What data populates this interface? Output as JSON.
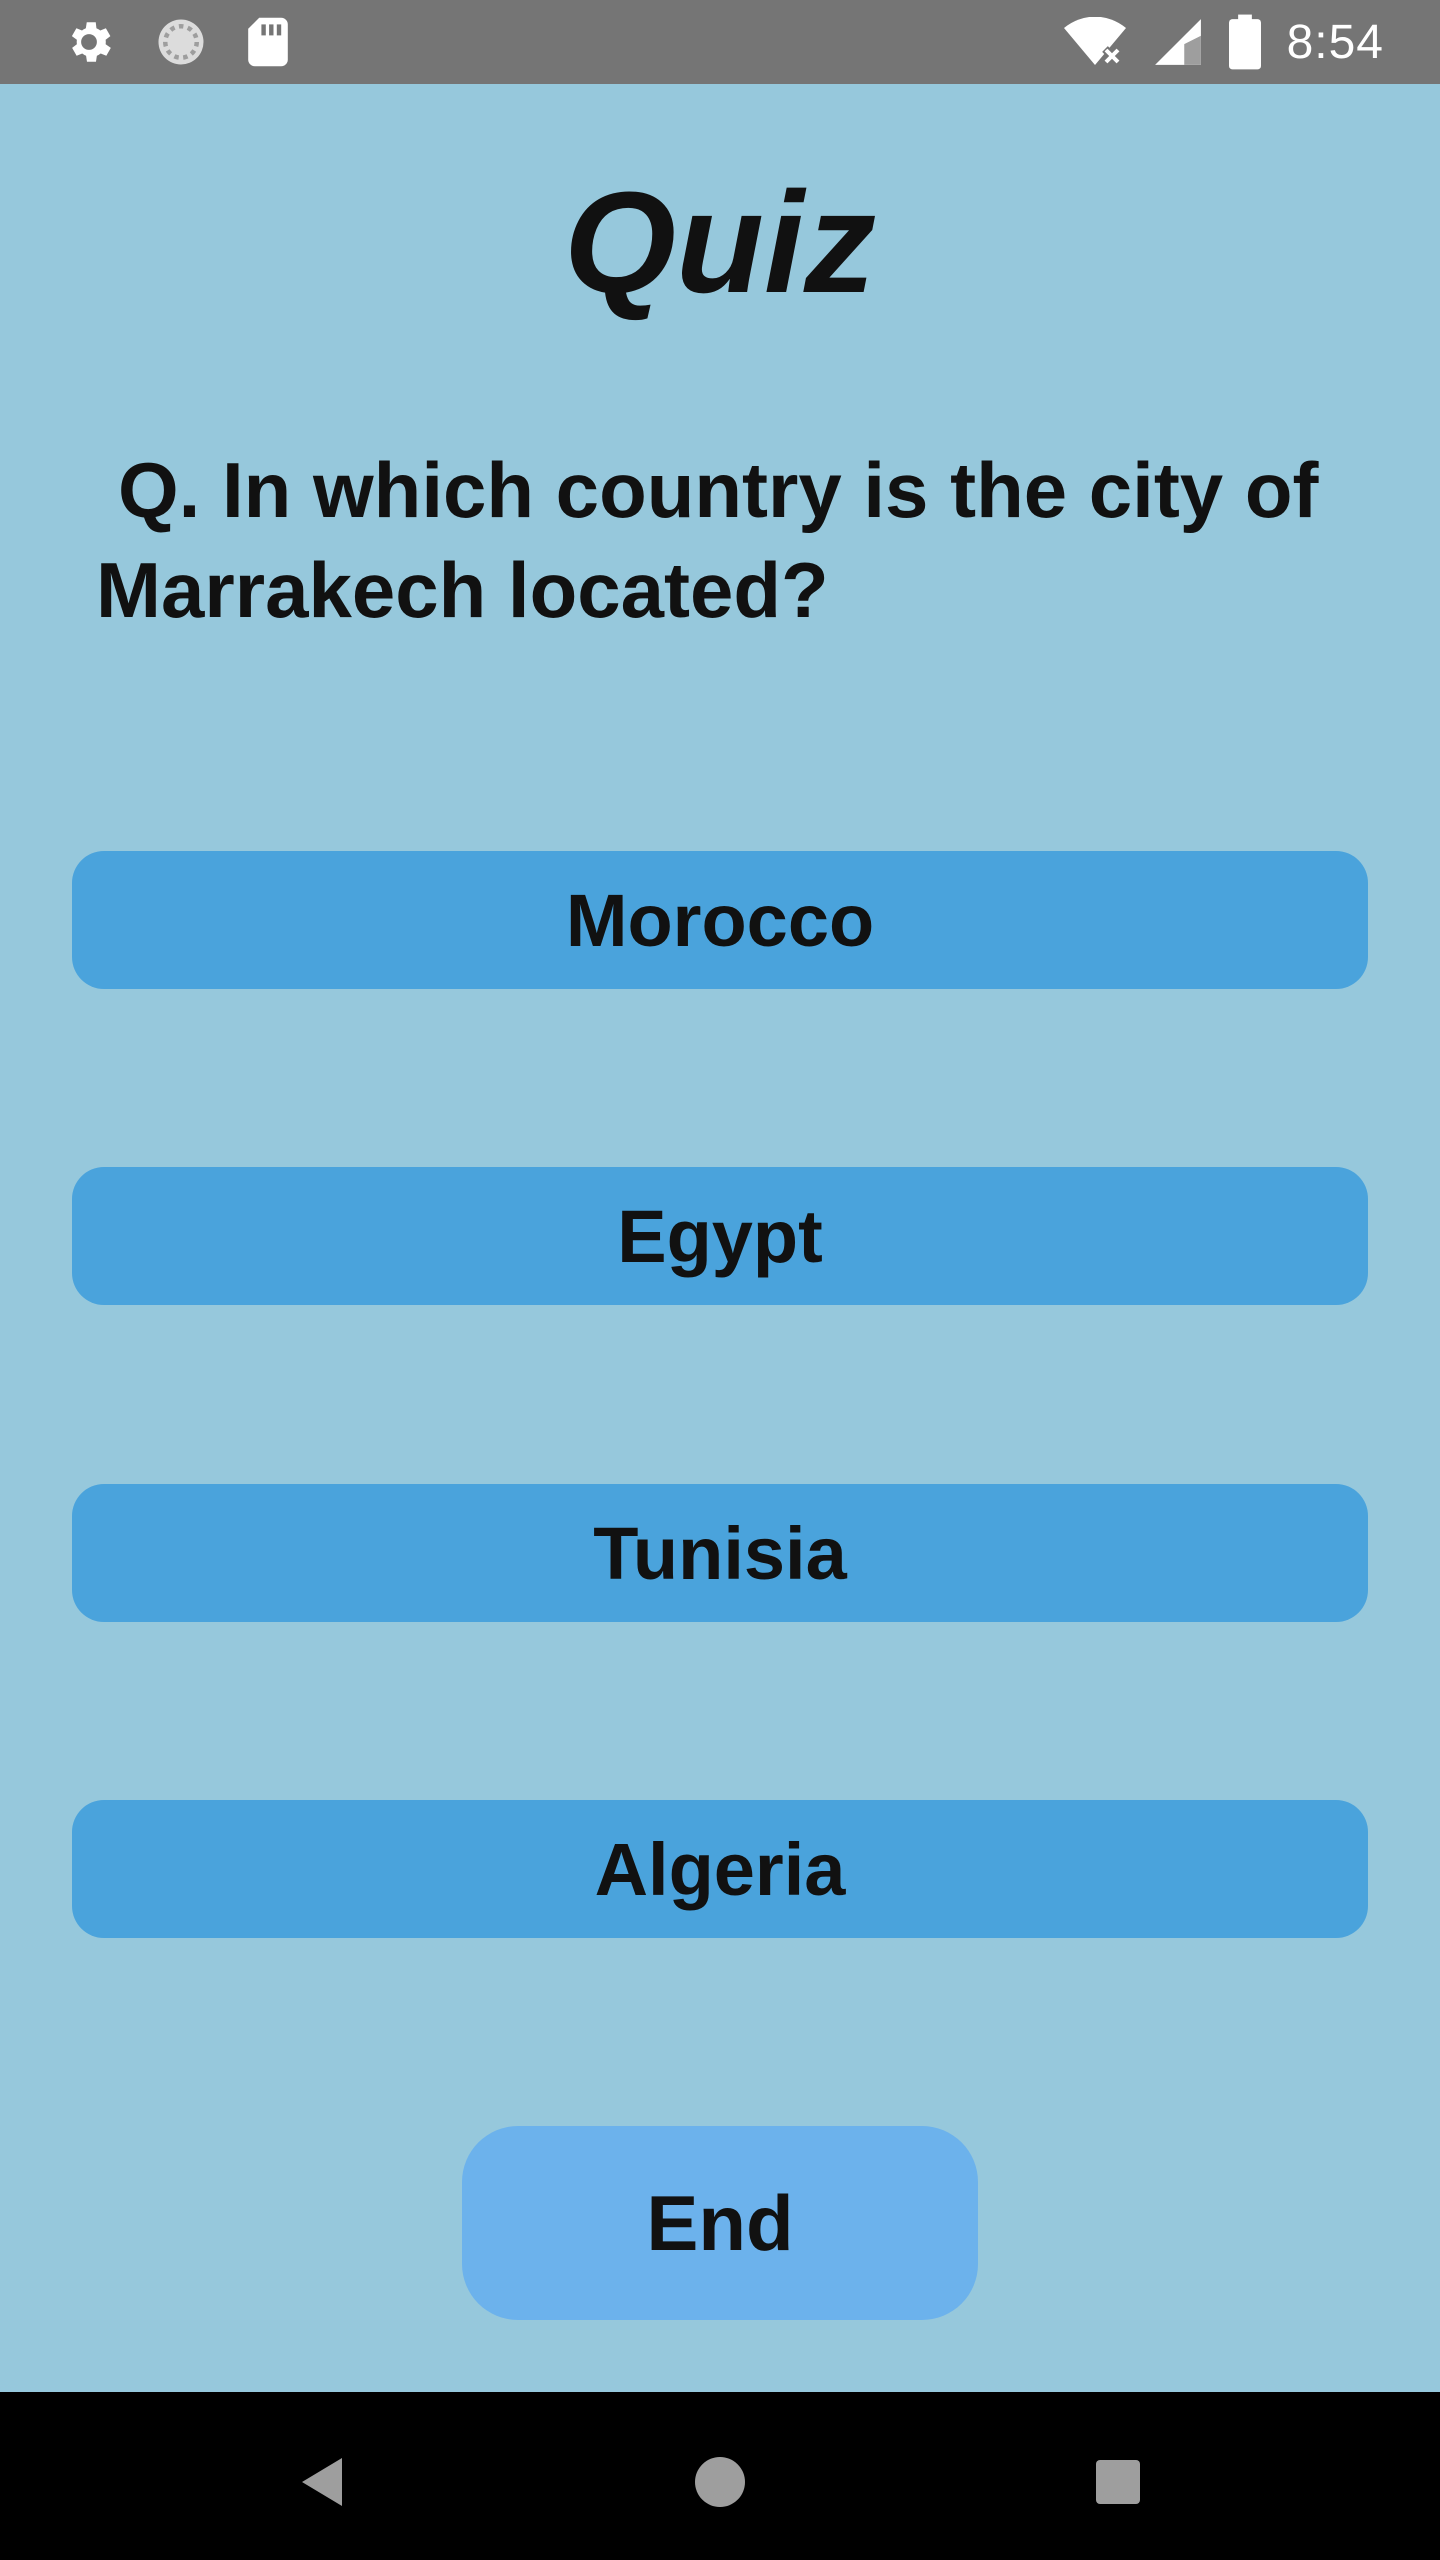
{
  "status_bar": {
    "time": "8:54",
    "icons_left": [
      "settings-icon",
      "sync-icon",
      "sd-card-icon"
    ],
    "icons_right": [
      "wifi-icon",
      "signal-icon",
      "battery-icon"
    ]
  },
  "quiz": {
    "title": "Quiz",
    "question": "Q. In which country is the city of Marrakech located?",
    "answers": [
      "Morocco",
      "Egypt",
      "Tunisia",
      "Algeria"
    ],
    "end_label": "End"
  },
  "nav_bar": {
    "buttons": [
      "back-icon",
      "home-icon",
      "recents-icon"
    ]
  },
  "colors": {
    "background": "#96c8dc",
    "answer_button": "#4aa3dc",
    "end_button": "#6cb2ec",
    "status_bar": "#757575",
    "nav_bar": "#000000"
  }
}
